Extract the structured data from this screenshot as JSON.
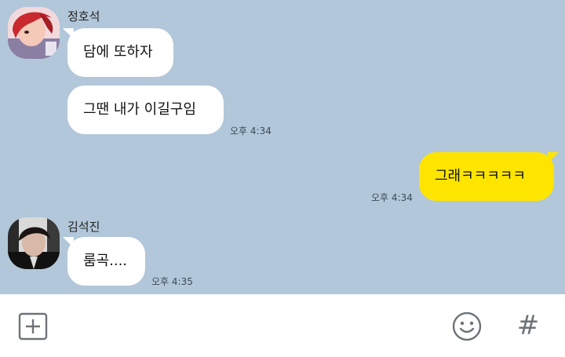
{
  "messages": [
    {
      "sender": "정호석",
      "text": "담에 또하자",
      "time": ""
    },
    {
      "sender": "",
      "text": "그땐 내가 이길구임",
      "time": "오후 4:34"
    },
    {
      "sender": "me",
      "text": "그래ㅋㅋㅋㅋㅋ",
      "time": "오후 4:34"
    },
    {
      "sender": "김석진",
      "text": "룸곡....",
      "time": "오후 4:35"
    }
  ],
  "contacts": {
    "hoseok": {
      "name": "정호석",
      "avatar_icon": "avatar-red-hair-portrait"
    },
    "seokjin": {
      "name": "김석진",
      "avatar_icon": "avatar-dark-hair-portrait"
    }
  },
  "input_bar": {
    "add_icon": "plus-square-icon",
    "emoji_icon": "smiley-icon",
    "hashtag_icon": "hashtag-icon",
    "hashtag_glyph": "#"
  },
  "colors": {
    "chat_background": "#b2c7d9",
    "my_bubble": "#fee500",
    "other_bubble": "#ffffff"
  }
}
